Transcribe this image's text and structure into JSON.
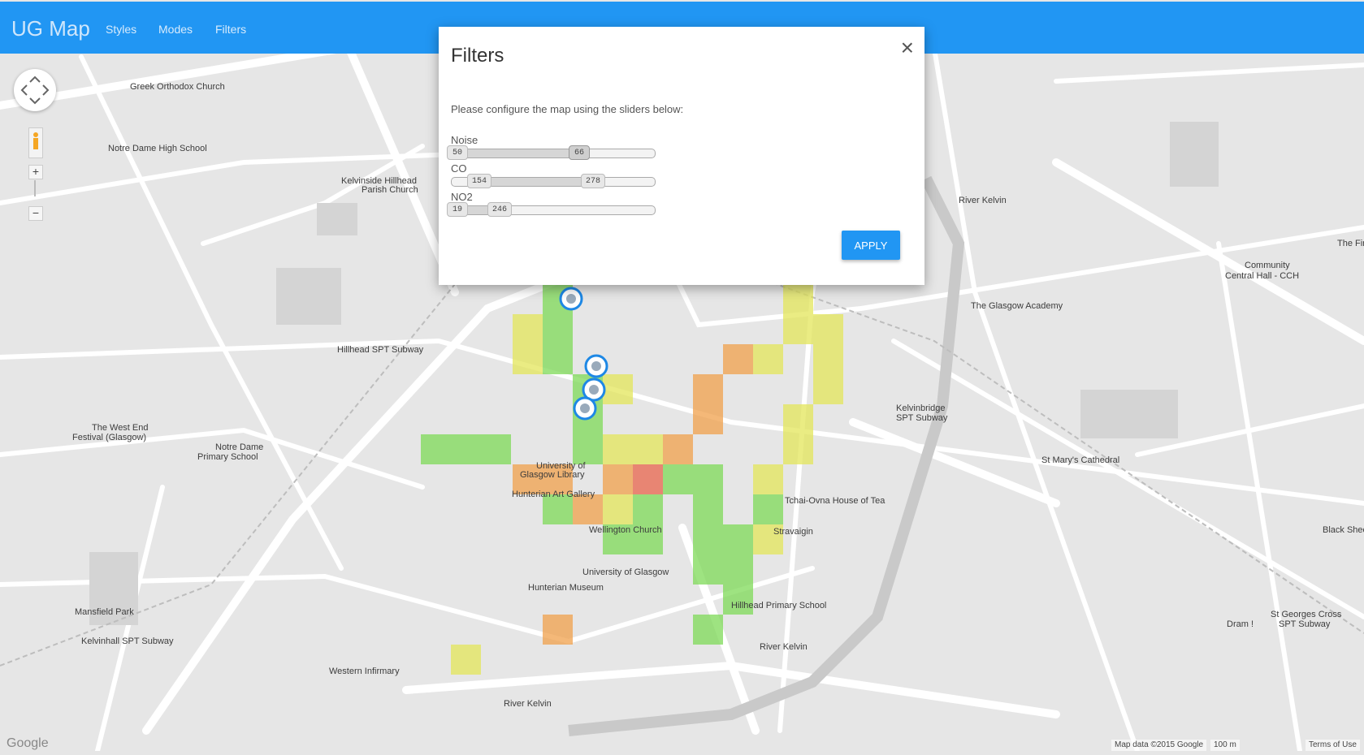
{
  "app": {
    "title": "UG Map",
    "nav": [
      "Styles",
      "Modes",
      "Filters"
    ]
  },
  "dialog": {
    "title": "Filters",
    "close": "×",
    "instructions": "Please configure the map using the sliders below:",
    "sliders": [
      {
        "label": "Noise",
        "min": 50,
        "high": 66,
        "low_shown": "50",
        "high_shown": "66",
        "range_low": 0.0,
        "range_high": 0.6
      },
      {
        "label": "CO",
        "min": 154,
        "high": 278,
        "low_shown": "154",
        "high_shown": "278",
        "range_low": 0.1,
        "range_high": 0.66
      },
      {
        "label": "NO2",
        "min": 19,
        "high": 246,
        "low_shown": "19",
        "high_shown": "246",
        "range_low": 0.0,
        "range_high": 0.2
      }
    ],
    "apply_label": "APPLY"
  },
  "map": {
    "labels": [
      "Greek Orthodox Church",
      "Notre Dame High School",
      "Kelvinside Hillhead",
      "Parish Church",
      "Hillhead SPT Subway",
      "The West End",
      "Festival (Glasgow)",
      "Notre Dame",
      "Primary School",
      "University of",
      "Glasgow Library",
      "Hunterian Art Gallery",
      "Wellington Church",
      "University of Glasgow",
      "Hunterian Museum",
      "Hillhead Primary School",
      "Mansfield Park",
      "Kelvinhall SPT Subway",
      "Western Infirmary",
      "River Kelvin",
      "River Kelvin",
      "River Kelvin",
      "Community",
      "Central Hall - CCH",
      "The Glasgow Academy",
      "Kelvinbridge",
      "SPT Subway",
      "St Mary's Cathedral",
      "Tchai-Ovna House of Tea",
      "Stravaigin",
      "Black Sheep Bistro",
      "Dram !",
      "St Georges Cross",
      "SPT Subway",
      "The Fir"
    ],
    "zoom_in": "+",
    "zoom_out": "−",
    "attribution": "Map data ©2015 Google",
    "scale": "100 m",
    "terms": "Terms of Use",
    "google": "Google",
    "colors": {
      "green": "#7ed957",
      "yellow": "#e3e65a",
      "orange": "#f0a04b",
      "red": "#e8644c",
      "topbar": "#2196f3"
    }
  }
}
